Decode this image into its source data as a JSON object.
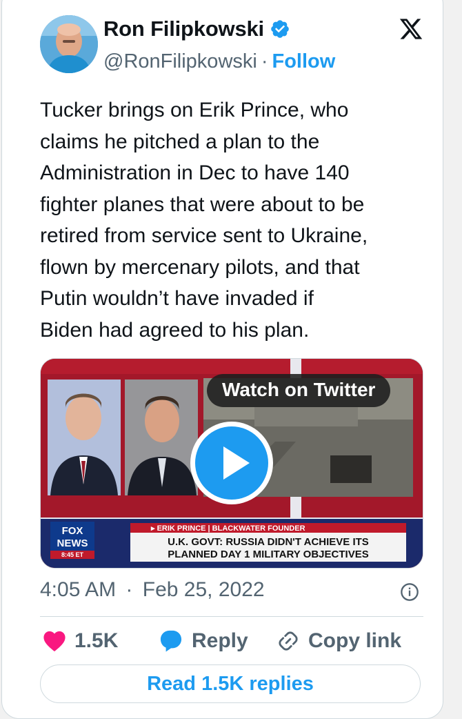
{
  "author": {
    "name": "Ron Filipkowski",
    "handle": "@RonFilipkowski",
    "separator": "·",
    "follow_label": "Follow"
  },
  "tweet": {
    "lines": [
      "Tucker brings on Erik Prince, who",
      "claims he pitched a plan to the",
      "Administration in Dec to have 140",
      "fighter planes that were about to be",
      "retired from service sent to Ukraine,",
      "flown by mercenary pilots, and that",
      "Putin wouldn’t have invaded if",
      "Biden had agreed to his plan."
    ]
  },
  "media": {
    "watch_label": "Watch on Twitter",
    "chyron_name": "▸ ERIK PRINCE | BLACKWATER FOUNDER",
    "chyron_line1": "U.K. GOVT: RUSSIA DIDN'T ACHIEVE ITS",
    "chyron_line2": "PLANNED DAY 1 MILITARY OBJECTIVES",
    "network_line1": "FOX",
    "network_line2": "NEWS",
    "clock": "8:45 ET"
  },
  "meta": {
    "time": "4:05 AM",
    "separator": "·",
    "date": "Feb 25, 2022"
  },
  "actions": {
    "likes": "1.5K",
    "reply_label": "Reply",
    "copy_label": "Copy link",
    "read_replies_label": "Read 1.5K replies"
  },
  "colors": {
    "accent": "#1d9bf0",
    "like_heart": "#f91880",
    "muted_text": "#536471",
    "fox_red": "#b0121f"
  },
  "icons": [
    "verified-badge-icon",
    "x-logo-icon",
    "play-icon",
    "info-icon",
    "heart-icon",
    "reply-bubble-icon",
    "link-icon"
  ]
}
